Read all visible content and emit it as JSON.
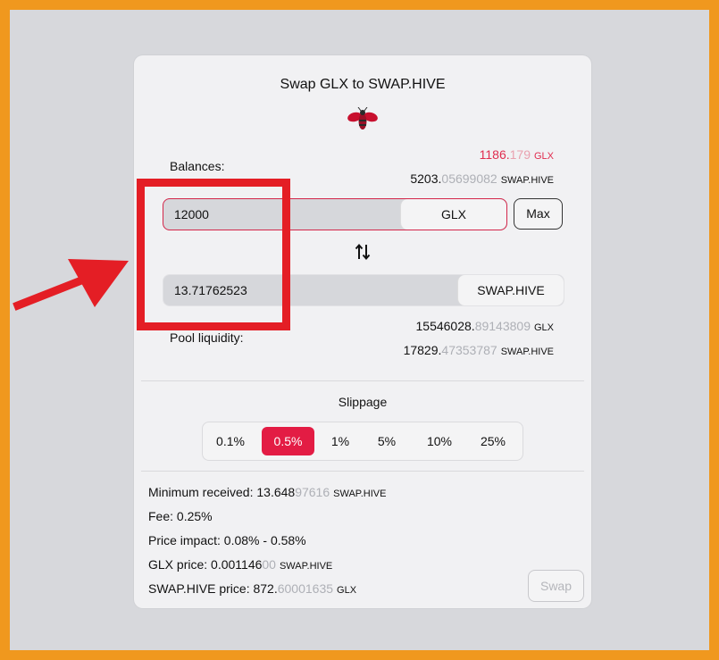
{
  "modal": {
    "title": "Swap GLX to SWAP.HIVE"
  },
  "balances": {
    "label": "Balances:",
    "glx": {
      "whole": "1186.",
      "frac": "179",
      "unit": "GLX"
    },
    "swaphive": {
      "whole": "5203.",
      "frac": "05699082",
      "unit": "SWAP.HIVE"
    }
  },
  "input": {
    "value": "12000",
    "token": "GLX",
    "max_label": "Max"
  },
  "output": {
    "value": "13.71762523",
    "token": "SWAP.HIVE"
  },
  "pool": {
    "label": "Pool liquidity:",
    "glx": {
      "whole": "15546028.",
      "frac": "89143809",
      "unit": "GLX"
    },
    "swaphive": {
      "whole": "17829.",
      "frac": "47353787",
      "unit": "SWAP.HIVE"
    }
  },
  "slippage": {
    "title": "Slippage",
    "options": [
      "0.1%",
      "0.5%",
      "1%",
      "5%",
      "10%",
      "25%"
    ],
    "selected": "0.5%"
  },
  "details": {
    "min_received": {
      "label": "Minimum received: ",
      "whole": "13.648",
      "frac": "97616",
      "unit": "SWAP.HIVE"
    },
    "fee": "Fee: 0.25%",
    "price_impact": "Price impact: 0.08% - 0.58%",
    "glx_price": {
      "label": "GLX price: ",
      "whole": "0.001146",
      "frac": "00",
      "unit": "SWAP.HIVE"
    },
    "swaphive_price": {
      "label": "SWAP.HIVE price: ",
      "whole": "872.",
      "frac": "60001635",
      "unit": "GLX"
    }
  },
  "swap_button": "Swap",
  "colors": {
    "frame": "#f0981e",
    "accent": "#e31c44",
    "annotation": "#e41e25"
  }
}
